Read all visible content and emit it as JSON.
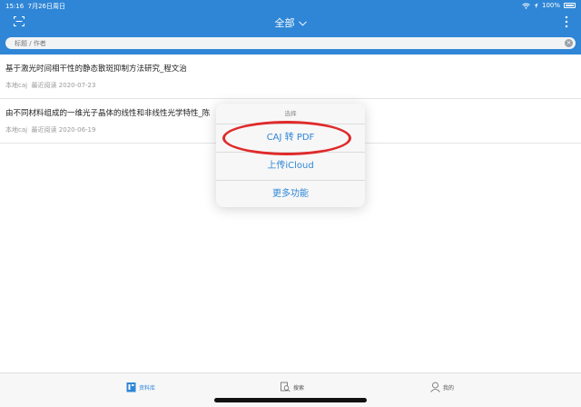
{
  "status": {
    "time": "15:16",
    "date": "7月26日周日",
    "battery": "100%"
  },
  "nav": {
    "title": "全部",
    "chevron": "chevron-down-icon"
  },
  "search": {
    "placeholder": "标题 / 作者"
  },
  "list": [
    {
      "title": "基于激光时间相干性的静态散斑抑制方法研究_程文治",
      "source": "本地caj",
      "recent_label": "最近阅读",
      "date": "2020-07-23"
    },
    {
      "title": "由不同材料组成的一维光子晶体的线性和非线性光学特性_陈",
      "source": "本地caj",
      "recent_label": "最近阅读",
      "date": "2020-06-19"
    }
  ],
  "popover": {
    "header": "选择",
    "options": [
      "CAJ 转 PDF",
      "上传iCloud",
      "更多功能"
    ]
  },
  "tabs": [
    {
      "label": "资料库",
      "icon": "library-icon",
      "active": true
    },
    {
      "label": "搜索",
      "icon": "search-icon",
      "active": false
    },
    {
      "label": "我的",
      "icon": "profile-icon",
      "active": false
    }
  ],
  "colors": {
    "accent": "#2f86d6",
    "annotation_ring": "#e02a2a",
    "meta": "#999999"
  }
}
